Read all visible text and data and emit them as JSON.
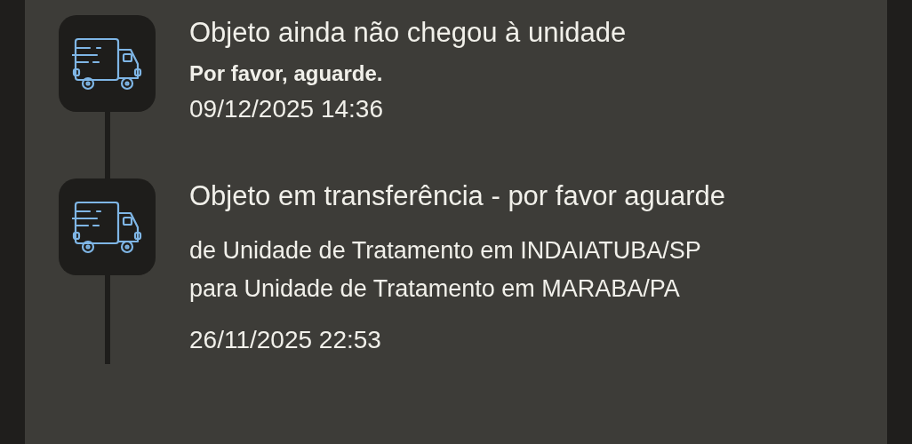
{
  "events": [
    {
      "title": "Objeto ainda não chegou à unidade",
      "note": "Por favor, aguarde.",
      "date": "09/12/2025 14:36"
    },
    {
      "title": "Objeto em transferência - por favor aguarde",
      "details": [
        "de Unidade de Tratamento em INDAIATUBA/SP",
        "para Unidade de Tratamento em MARABA/PA"
      ],
      "date": "26/11/2025 22:53"
    }
  ]
}
